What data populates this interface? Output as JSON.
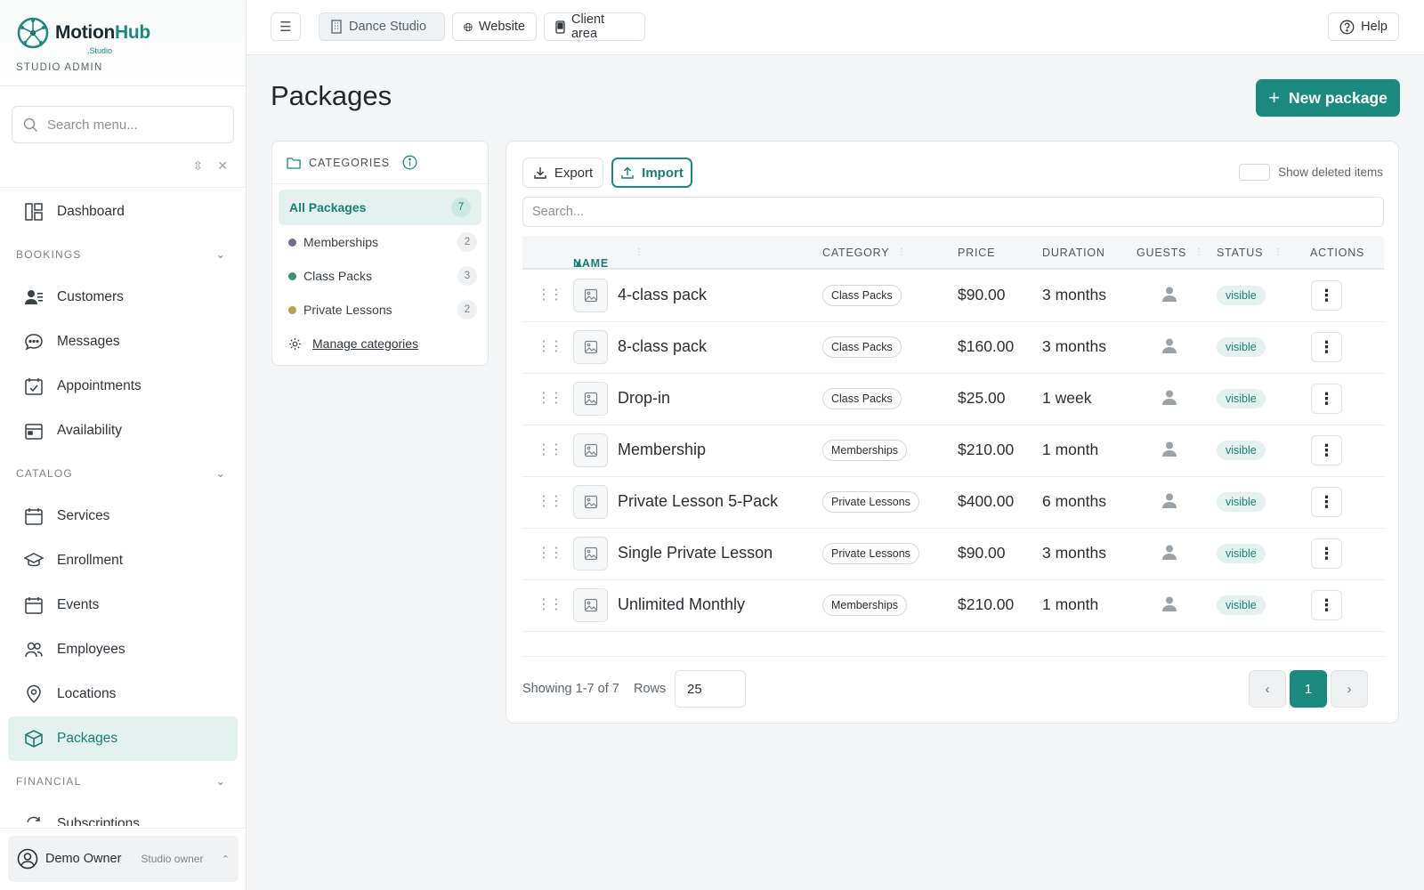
{
  "brand": {
    "name_a": "Motion",
    "name_b": "Hub",
    "sub": ".Studio",
    "role": "STUDIO ADMIN"
  },
  "sidebar": {
    "search_placeholder": "Search menu...",
    "items": [
      {
        "label": "Dashboard",
        "icon": "dashboard-icon"
      },
      {
        "section": "BOOKINGS"
      },
      {
        "label": "Customers",
        "icon": "customers-icon"
      },
      {
        "label": "Messages",
        "icon": "messages-icon"
      },
      {
        "label": "Appointments",
        "icon": "calendar-check-icon"
      },
      {
        "label": "Availability",
        "icon": "calendar-icon"
      },
      {
        "section": "CATALOG"
      },
      {
        "label": "Services",
        "icon": "services-icon"
      },
      {
        "label": "Enrollment",
        "icon": "graduation-cap-icon"
      },
      {
        "label": "Events",
        "icon": "event-calendar-icon"
      },
      {
        "label": "Employees",
        "icon": "employees-icon"
      },
      {
        "label": "Locations",
        "icon": "map-pin-icon"
      },
      {
        "label": "Packages",
        "icon": "package-icon",
        "active": true
      },
      {
        "section": "FINANCIAL"
      },
      {
        "label": "Subscriptions",
        "icon": "refresh-icon"
      }
    ],
    "user": {
      "name": "Demo Owner",
      "role": "Studio owner"
    }
  },
  "topbar": {
    "studio": "Dance Studio",
    "website": "Website",
    "client_area": "Client area",
    "help": "Help"
  },
  "page": {
    "title": "Packages",
    "new_button": "New package"
  },
  "categories": {
    "heading": "CATEGORIES",
    "items": [
      {
        "label": "All Packages",
        "count": "7",
        "active": true
      },
      {
        "label": "Memberships",
        "count": "2",
        "color": "#6b6f8a"
      },
      {
        "label": "Class Packs",
        "count": "3",
        "color": "#3e8f78"
      },
      {
        "label": "Private Lessons",
        "count": "2",
        "color": "#c29a4a"
      }
    ],
    "manage": "Manage categories"
  },
  "table": {
    "export": "Export",
    "import": "Import",
    "show_deleted": "Show deleted items",
    "search_placeholder": "Search...",
    "headers": {
      "name": "NAME",
      "category": "CATEGORY",
      "price": "PRICE",
      "duration": "DURATION",
      "guests": "GUESTS",
      "status": "STATUS",
      "actions": "ACTIONS"
    },
    "rows": [
      {
        "name": "4-class pack",
        "category": "Class Packs",
        "price": "$90.00",
        "duration": "3 months",
        "status": "visible"
      },
      {
        "name": "8-class pack",
        "category": "Class Packs",
        "price": "$160.00",
        "duration": "3 months",
        "status": "visible"
      },
      {
        "name": "Drop-in",
        "category": "Class Packs",
        "price": "$25.00",
        "duration": "1 week",
        "status": "visible"
      },
      {
        "name": "Membership",
        "category": "Memberships",
        "price": "$210.00",
        "duration": "1 month",
        "status": "visible"
      },
      {
        "name": "Private Lesson 5-Pack",
        "category": "Private Lessons",
        "price": "$400.00",
        "duration": "6 months",
        "status": "visible"
      },
      {
        "name": "Single Private Lesson",
        "category": "Private Lessons",
        "price": "$90.00",
        "duration": "3 months",
        "status": "visible"
      },
      {
        "name": "Unlimited Monthly",
        "category": "Memberships",
        "price": "$210.00",
        "duration": "1 month",
        "status": "visible"
      }
    ],
    "footer": {
      "showing": "Showing 1-7 of 7",
      "rows_label": "Rows",
      "rows_value": "25",
      "page": "1"
    }
  },
  "colors": {
    "accent": "#1a8a7e",
    "accent_light": "#e3f2ef"
  }
}
